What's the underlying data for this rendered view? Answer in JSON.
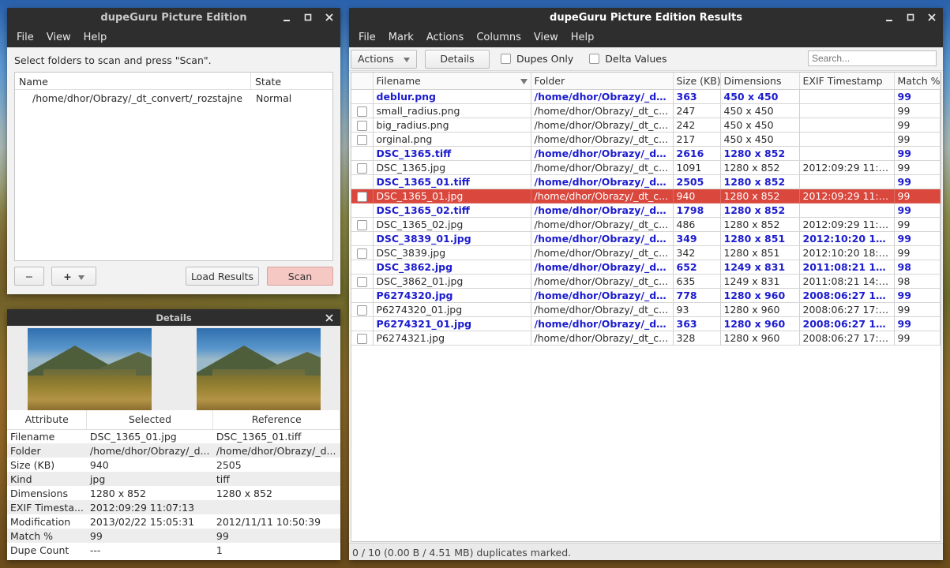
{
  "main_window": {
    "title": "dupeGuru Picture Edition",
    "menu": [
      "File",
      "View",
      "Help"
    ],
    "instruction": "Select folders to scan and press \"Scan\".",
    "tree_headers": [
      "Name",
      "State"
    ],
    "folders": [
      {
        "name": "/home/dhor/Obrazy/_dt_convert/_rozstajne",
        "state": "Normal"
      }
    ],
    "remove_label": "−",
    "add_label": "+",
    "load_results_label": "Load Results",
    "scan_label": "Scan",
    "scan_color": "#f5c8c4"
  },
  "details_window": {
    "title": "Details",
    "headers": [
      "Attribute",
      "Selected",
      "Reference"
    ],
    "rows": [
      [
        "Filename",
        "DSC_1365_01.jpg",
        "DSC_1365_01.tiff"
      ],
      [
        "Folder",
        "/home/dhor/Obrazy/_d...",
        "/home/dhor/Obrazy/_d..."
      ],
      [
        "Size (KB)",
        "940",
        "2505"
      ],
      [
        "Kind",
        "jpg",
        "tiff"
      ],
      [
        "Dimensions",
        "1280 x 852",
        "1280 x 852"
      ],
      [
        "EXIF Timesta...",
        "2012:09:29 11:07:13",
        ""
      ],
      [
        "Modification",
        "2013/02/22 15:05:31",
        "2012/11/11 10:50:39"
      ],
      [
        "Match %",
        "99",
        "99"
      ],
      [
        "Dupe Count",
        "---",
        "1"
      ]
    ]
  },
  "results_window": {
    "title": "dupeGuru Picture Edition Results",
    "menu": [
      "File",
      "Mark",
      "Actions",
      "Columns",
      "View",
      "Help"
    ],
    "actions_label": "Actions",
    "details_label": "Details",
    "dupes_only_label": "Dupes Only",
    "delta_values_label": "Delta Values",
    "search_placeholder": "Search...",
    "columns": [
      "Filename",
      "Folder",
      "Size (KB)",
      "Dimensions",
      "EXIF Timestamp",
      "Match %"
    ],
    "rows": [
      {
        "ref": true,
        "cells": [
          "deblur.png",
          "/home/dhor/Obrazy/_dt_...",
          "363",
          "450 x 450",
          "",
          "99"
        ]
      },
      {
        "ref": false,
        "cells": [
          "small_radius.png",
          "/home/dhor/Obrazy/_dt_c...",
          "247",
          "450 x 450",
          "",
          "99"
        ]
      },
      {
        "ref": false,
        "cells": [
          "big_radius.png",
          "/home/dhor/Obrazy/_dt_c...",
          "242",
          "450 x 450",
          "",
          "99"
        ]
      },
      {
        "ref": false,
        "cells": [
          "orginal.png",
          "/home/dhor/Obrazy/_dt_c...",
          "217",
          "450 x 450",
          "",
          "99"
        ]
      },
      {
        "ref": true,
        "cells": [
          "DSC_1365.tiff",
          "/home/dhor/Obrazy/_dt_...",
          "2616",
          "1280 x 852",
          "",
          "99"
        ]
      },
      {
        "ref": false,
        "cells": [
          "DSC_1365.jpg",
          "/home/dhor/Obrazy/_dt_c...",
          "1091",
          "1280 x 852",
          "2012:09:29 11:0...",
          "99"
        ]
      },
      {
        "ref": true,
        "cells": [
          "DSC_1365_01.tiff",
          "/home/dhor/Obrazy/_dt_...",
          "2505",
          "1280 x 852",
          "",
          "99"
        ]
      },
      {
        "ref": false,
        "selected": true,
        "cells": [
          "DSC_1365_01.jpg",
          "/home/dhor/Obrazy/_dt_c...",
          "940",
          "1280 x 852",
          "2012:09:29 11:0...",
          "99"
        ]
      },
      {
        "ref": true,
        "cells": [
          "DSC_1365_02.tiff",
          "/home/dhor/Obrazy/_dt_...",
          "1798",
          "1280 x 852",
          "",
          "99"
        ]
      },
      {
        "ref": false,
        "cells": [
          "DSC_1365_02.jpg",
          "/home/dhor/Obrazy/_dt_c...",
          "486",
          "1280 x 852",
          "2012:09:29 11:0...",
          "99"
        ]
      },
      {
        "ref": true,
        "cells": [
          "DSC_3839_01.jpg",
          "/home/dhor/Obrazy/_dt_...",
          "349",
          "1280 x 851",
          "2012:10:20 18:0...",
          "99"
        ]
      },
      {
        "ref": false,
        "cells": [
          "DSC_3839.jpg",
          "/home/dhor/Obrazy/_dt_c...",
          "342",
          "1280 x 851",
          "2012:10:20 18:0...",
          "99"
        ]
      },
      {
        "ref": true,
        "cells": [
          "DSC_3862.jpg",
          "/home/dhor/Obrazy/_dt_...",
          "652",
          "1249 x 831",
          "2011:08:21 14:2...",
          "98"
        ]
      },
      {
        "ref": false,
        "cells": [
          "DSC_3862_01.jpg",
          "/home/dhor/Obrazy/_dt_c...",
          "635",
          "1249 x 831",
          "2011:08:21 14:2...",
          "98"
        ]
      },
      {
        "ref": true,
        "cells": [
          "P6274320.jpg",
          "/home/dhor/Obrazy/_dt_...",
          "778",
          "1280 x 960",
          "2008:06:27 17:1...",
          "99"
        ]
      },
      {
        "ref": false,
        "cells": [
          "P6274320_01.jpg",
          "/home/dhor/Obrazy/_dt_c...",
          "93",
          "1280 x 960",
          "2008:06:27 17:1...",
          "99"
        ]
      },
      {
        "ref": true,
        "cells": [
          "P6274321_01.jpg",
          "/home/dhor/Obrazy/_dt_...",
          "363",
          "1280 x 960",
          "2008:06:27 17:1...",
          "99"
        ]
      },
      {
        "ref": false,
        "cells": [
          "P6274321.jpg",
          "/home/dhor/Obrazy/_dt_c...",
          "328",
          "1280 x 960",
          "2008:06:27 17:1...",
          "99"
        ]
      }
    ],
    "status": "0 / 10 (0.00 B / 4.51 MB) duplicates marked.",
    "ref_color": "#1c1ccf",
    "selection_color": "#d9473d"
  },
  "icons": {
    "minimize": "minimize-icon",
    "maximize": "maximize-icon",
    "close": "close-icon",
    "sort": "sort-descending-icon",
    "dropdown": "chevron-down-icon"
  }
}
